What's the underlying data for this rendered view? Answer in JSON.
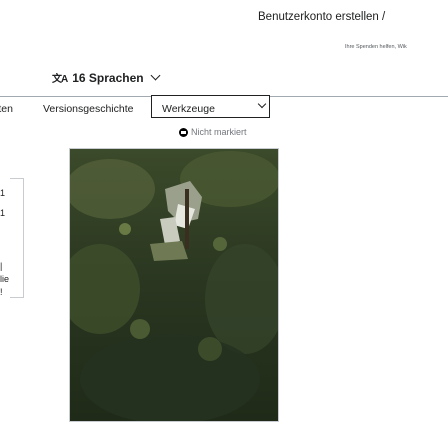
{
  "header": {
    "create_account": "Benutzerkonto erstellen  /",
    "donate_note": "Ihre Spenden helfen, Wik"
  },
  "languages": {
    "icon_text": "文A",
    "label": "16 Sprachen"
  },
  "tabs": {
    "partial_left": "iten",
    "history": "Versionsgeschichte",
    "tools": "Werkzeuge"
  },
  "status": {
    "icon": "flag-icon",
    "text": "Nicht markiert"
  },
  "left_edge": [
    "1",
    "1",
    "|",
    "lie",
    "!"
  ],
  "image": {
    "description_icon": "nature-photo"
  },
  "colors": {
    "link": "#202122",
    "border": "#a2a9b1",
    "muted": "#72777d"
  }
}
